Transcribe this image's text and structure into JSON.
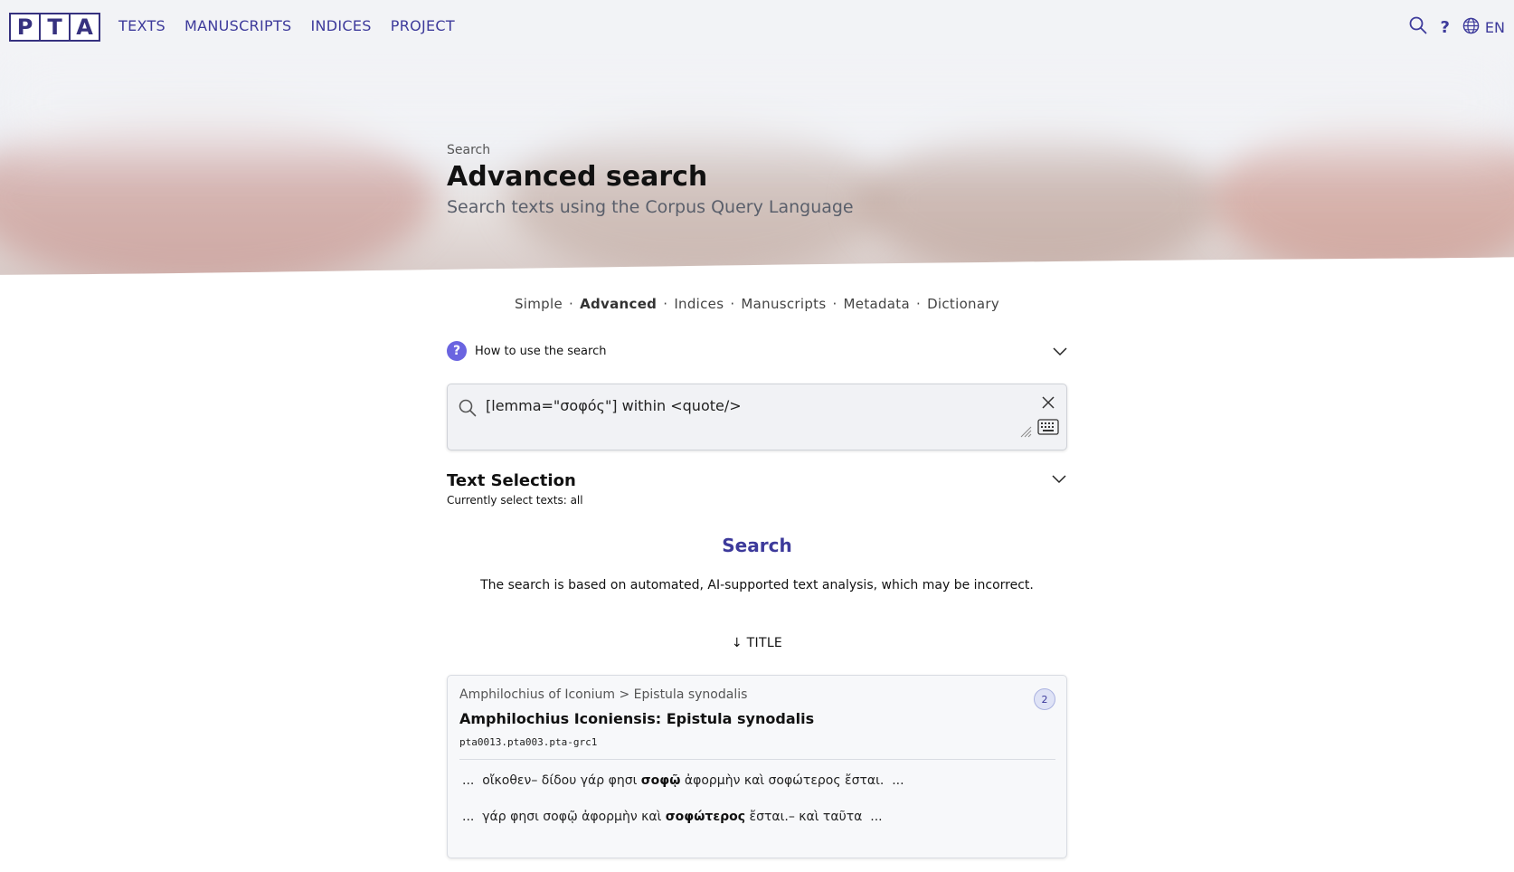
{
  "logo": {
    "letters": [
      "P",
      "T",
      "A"
    ]
  },
  "nav": {
    "texts": "TEXTS",
    "manuscripts": "MANUSCRIPTS",
    "indices": "INDICES",
    "project": "PROJECT"
  },
  "tools": {
    "help": "?",
    "language": "EN",
    "search_icon": "search-icon",
    "globe_icon": "globe-icon"
  },
  "hero": {
    "breadcrumb": "Search",
    "title": "Advanced search",
    "subtitle": "Search texts using the Corpus Query Language"
  },
  "subnav": {
    "items": [
      "Simple",
      "Advanced",
      "Indices",
      "Manuscripts",
      "Metadata",
      "Dictionary"
    ],
    "active": "Advanced"
  },
  "howto": {
    "label": "How to use the search"
  },
  "search": {
    "query": "[lemma=\"σοφός\"] within <quote/>"
  },
  "text_selection": {
    "title": "Text Selection",
    "subtitle": "Currently select texts: all"
  },
  "search_button": "Search",
  "disclaimer": "The search is based on automated, AI-supported text analysis, which may be incorrect.",
  "sort_label": "↓ TITLE",
  "result": {
    "author": "Amphilochius of Iconium",
    "separator": ">",
    "work": "Epistula synodalis",
    "count": "2",
    "title": "Amphilochius Iconiensis: Epistula synodalis",
    "id": "pta0013.pta003.pta-grc1",
    "kwic": [
      {
        "pre": "...  οἴκοθεν– δίδου γάρ φησι ",
        "hit": "σοφῷ",
        "post": " ἀφορμὴν καὶ σοφώτερος ἔσται.  ..."
      },
      {
        "pre": "...  γάρ φησι σοφῷ ἀφορμὴν καὶ ",
        "hit": "σοφώτερος",
        "post": " ἔσται.– καὶ ταῦτα  ..."
      }
    ]
  },
  "colors": {
    "brand": "#3d3a9b",
    "accent": "#6a64e0"
  }
}
